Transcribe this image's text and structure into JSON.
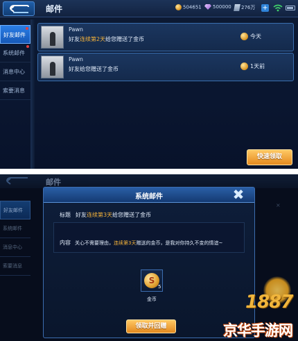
{
  "top": {
    "title": "邮件",
    "resources": {
      "coins": "504651",
      "diamonds": "500000",
      "vouchers": "276万"
    },
    "sidebar": [
      {
        "label": "好友邮件",
        "active": true
      },
      {
        "label": "系统邮件",
        "active": false
      },
      {
        "label": "消息中心",
        "active": false
      },
      {
        "label": "索要消息",
        "active": false
      }
    ],
    "mails": [
      {
        "sender": "Pawn",
        "msg_prefix": "好友",
        "msg_highlight": "连续第2天",
        "msg_suffix": "给您赠送了金币",
        "time": "今天"
      },
      {
        "sender": "Pawn",
        "msg_prefix": "好友给您赠送了金币",
        "msg_highlight": "",
        "msg_suffix": "",
        "time": "1天前"
      }
    ],
    "claim_label": "快速领取"
  },
  "bottom": {
    "bg_title": "邮件",
    "bg_sidebar": [
      "好友邮件",
      "系统邮件",
      "消息中心",
      "索要消息"
    ],
    "dialog": {
      "title": "系统邮件",
      "close": "✖",
      "subject_key": "标题",
      "subject_prefix": "好友",
      "subject_highlight": "连续第3天",
      "subject_suffix": "给您赠送了金币",
      "content_key": "内容",
      "content_prefix": "关心不需要理由，",
      "content_highlight": "连续第3天",
      "content_suffix": "赠送的金币，是我对你持久不变的情谊~",
      "reward": {
        "icon": "coin-icon",
        "quantity": "5",
        "name": "金币"
      },
      "button_label": "领取并回赠"
    },
    "bg_side_text": "×",
    "watermark": {
      "number": "1887",
      "text": "京华手游网"
    }
  },
  "colors": {
    "accent_blue": "#2b7ee6",
    "highlight_orange": "#f2b13a",
    "button_orange": "#e3891f"
  }
}
